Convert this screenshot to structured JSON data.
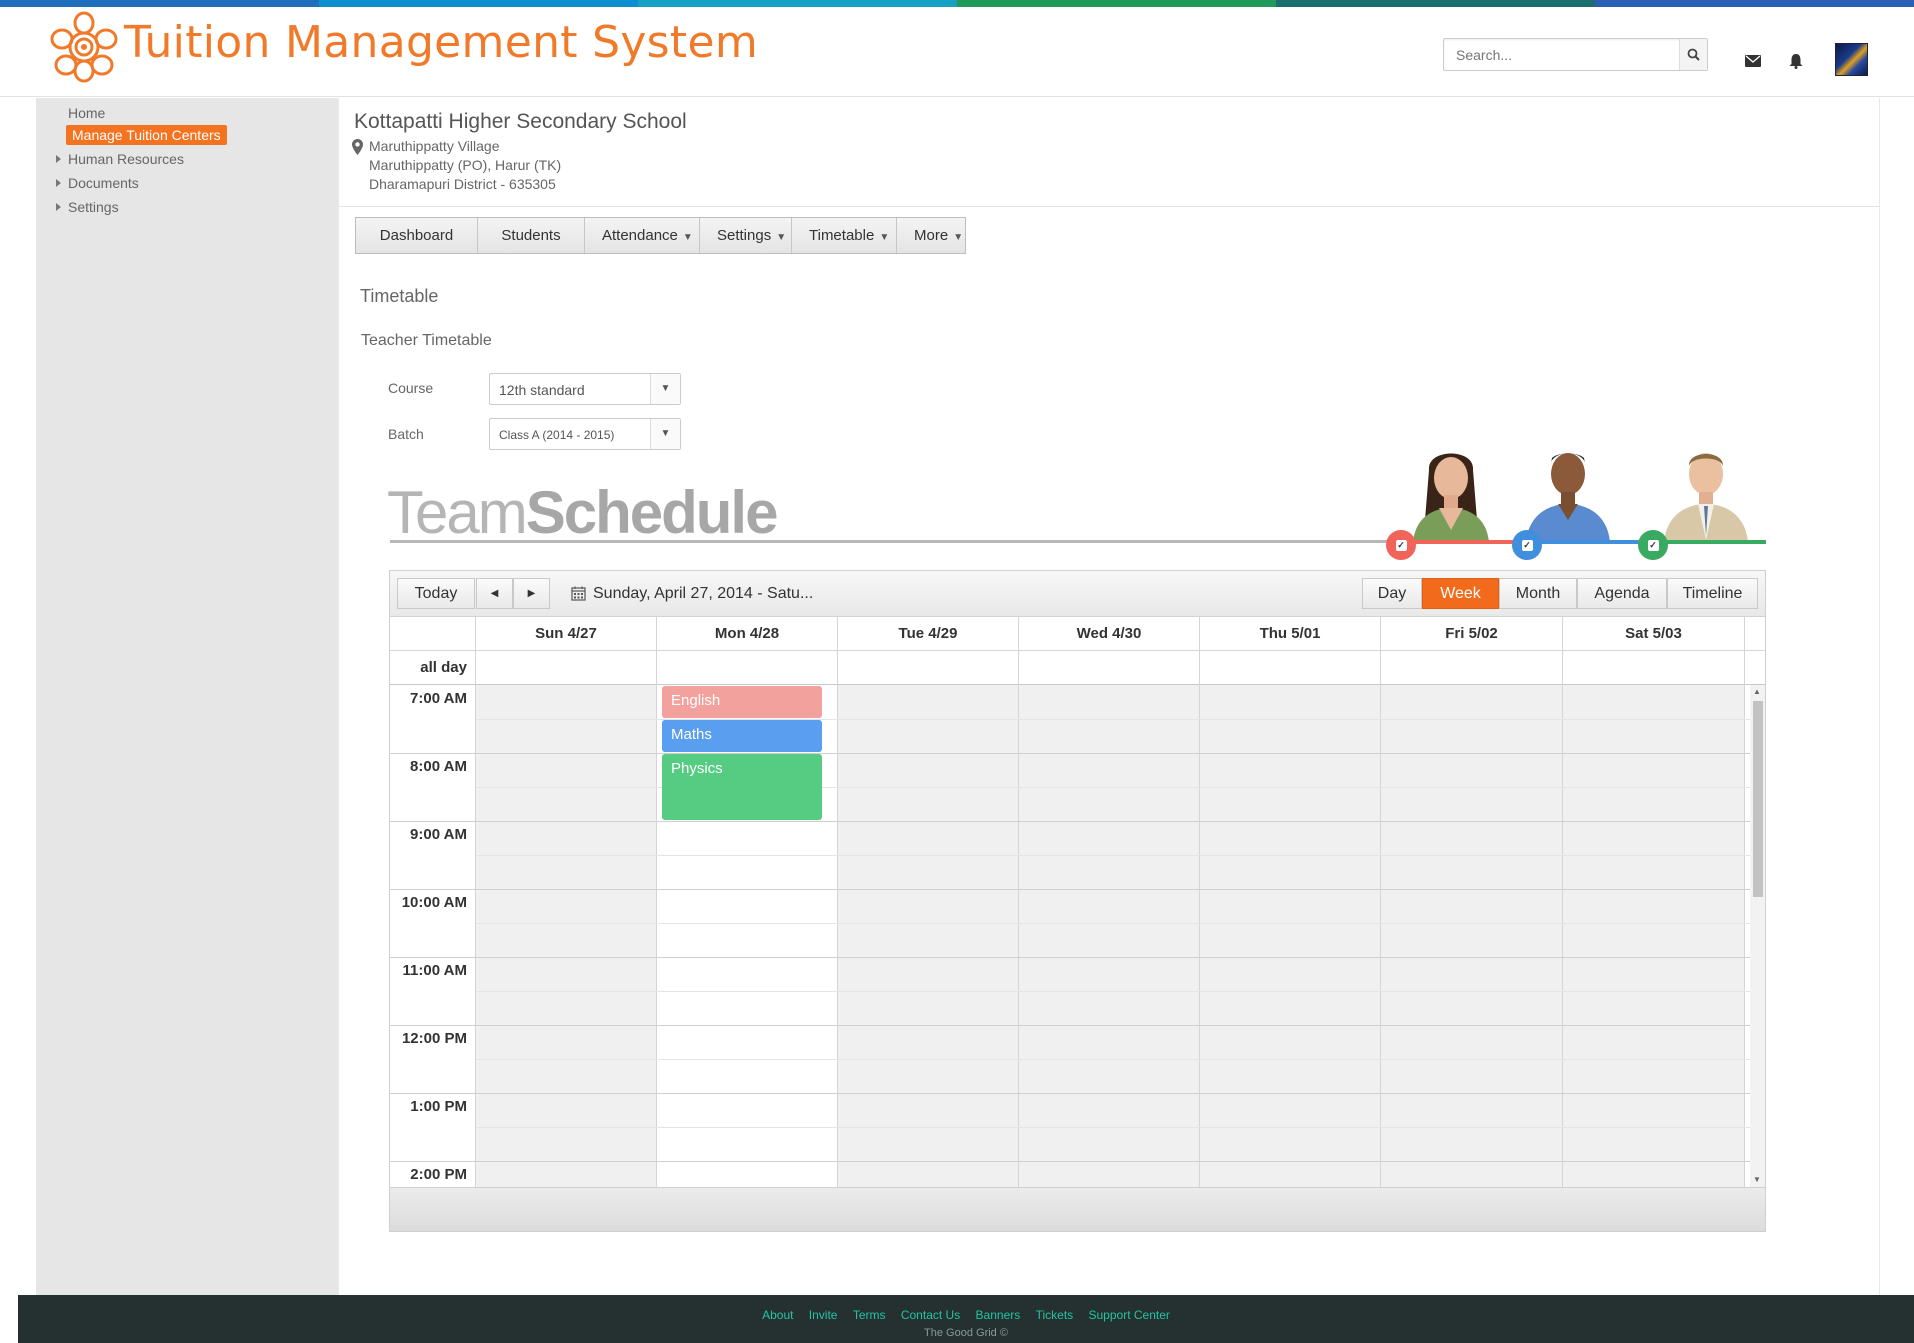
{
  "app": {
    "title": "Tuition Management System",
    "accent_color": "#f07a2a",
    "stripe_colors": [
      "#1d6fbe",
      "#0b8fd0",
      "#15a0c4",
      "#1f9a5a",
      "#1b6e70",
      "#2b5fb5"
    ]
  },
  "header": {
    "search_placeholder": "Search...",
    "icons": [
      "search-icon",
      "mail-icon",
      "bell-icon",
      "user-avatar"
    ]
  },
  "sidebar": {
    "items": [
      {
        "label": "Home",
        "active": false,
        "expandable": false
      },
      {
        "label": "Manage Tuition  Centers",
        "active": true,
        "expandable": false
      },
      {
        "label": "Human Resources",
        "active": false,
        "expandable": true
      },
      {
        "label": "Documents",
        "active": false,
        "expandable": true
      },
      {
        "label": "Settings",
        "active": false,
        "expandable": true
      }
    ]
  },
  "school": {
    "name": "Kottapatti Higher Secondary School",
    "address": [
      "Maruthippatty Village",
      "Maruthippatty (PO), Harur (TK)",
      "Dharamapuri District - 635305"
    ]
  },
  "tabs": [
    {
      "label": "Dashboard",
      "dropdown": false
    },
    {
      "label": "Students",
      "dropdown": false
    },
    {
      "label": "Attendance",
      "dropdown": true
    },
    {
      "label": "Settings",
      "dropdown": true
    },
    {
      "label": "Timetable",
      "dropdown": true
    },
    {
      "label": "More",
      "dropdown": true
    }
  ],
  "section": {
    "title": "Timetable",
    "subtitle": "Teacher Timetable"
  },
  "form": {
    "course_label": "Course",
    "course_value": "12th standard",
    "batch_label": "Batch",
    "batch_value": "Class A (2014 - 2015)"
  },
  "team_schedule": {
    "logo_light": "Team",
    "logo_bold": "Schedule",
    "people": [
      {
        "name": "teacher-1",
        "color": "#f0645a"
      },
      {
        "name": "teacher-2",
        "color": "#3f8fdc"
      },
      {
        "name": "teacher-3",
        "color": "#3aaa62"
      }
    ]
  },
  "scheduler": {
    "today_label": "Today",
    "date_range": "Sunday, April 27, 2014 - Satu...",
    "views": [
      {
        "label": "Day",
        "selected": false
      },
      {
        "label": "Week",
        "selected": true
      },
      {
        "label": "Month",
        "selected": false
      },
      {
        "label": "Agenda",
        "selected": false
      },
      {
        "label": "Timeline",
        "selected": false
      }
    ],
    "days": [
      "Sun 4/27",
      "Mon 4/28",
      "Tue 4/29",
      "Wed 4/30",
      "Thu 5/01",
      "Fri 5/02",
      "Sat 5/03"
    ],
    "all_day_label": "all day",
    "times": [
      "7:00 AM",
      "8:00 AM",
      "9:00 AM",
      "10:00 AM",
      "11:00 AM",
      "12:00 PM",
      "1:00 PM",
      "2:00 PM"
    ],
    "events": [
      {
        "title": "English",
        "day": "Mon 4/28",
        "start": "7:00 AM",
        "end": "7:30 AM",
        "color": "#f3a19c"
      },
      {
        "title": "Maths",
        "day": "Mon 4/28",
        "start": "7:30 AM",
        "end": "8:00 AM",
        "color": "#5a9ef0"
      },
      {
        "title": "Physics",
        "day": "Mon 4/28",
        "start": "8:00 AM",
        "end": "9:00 AM",
        "color": "#55cc82"
      }
    ]
  },
  "footer": {
    "links": [
      "About",
      "Invite",
      "Terms",
      "Contact Us",
      "Banners",
      "Tickets",
      "Support Center"
    ],
    "copyright": "The Good Grid ©"
  }
}
